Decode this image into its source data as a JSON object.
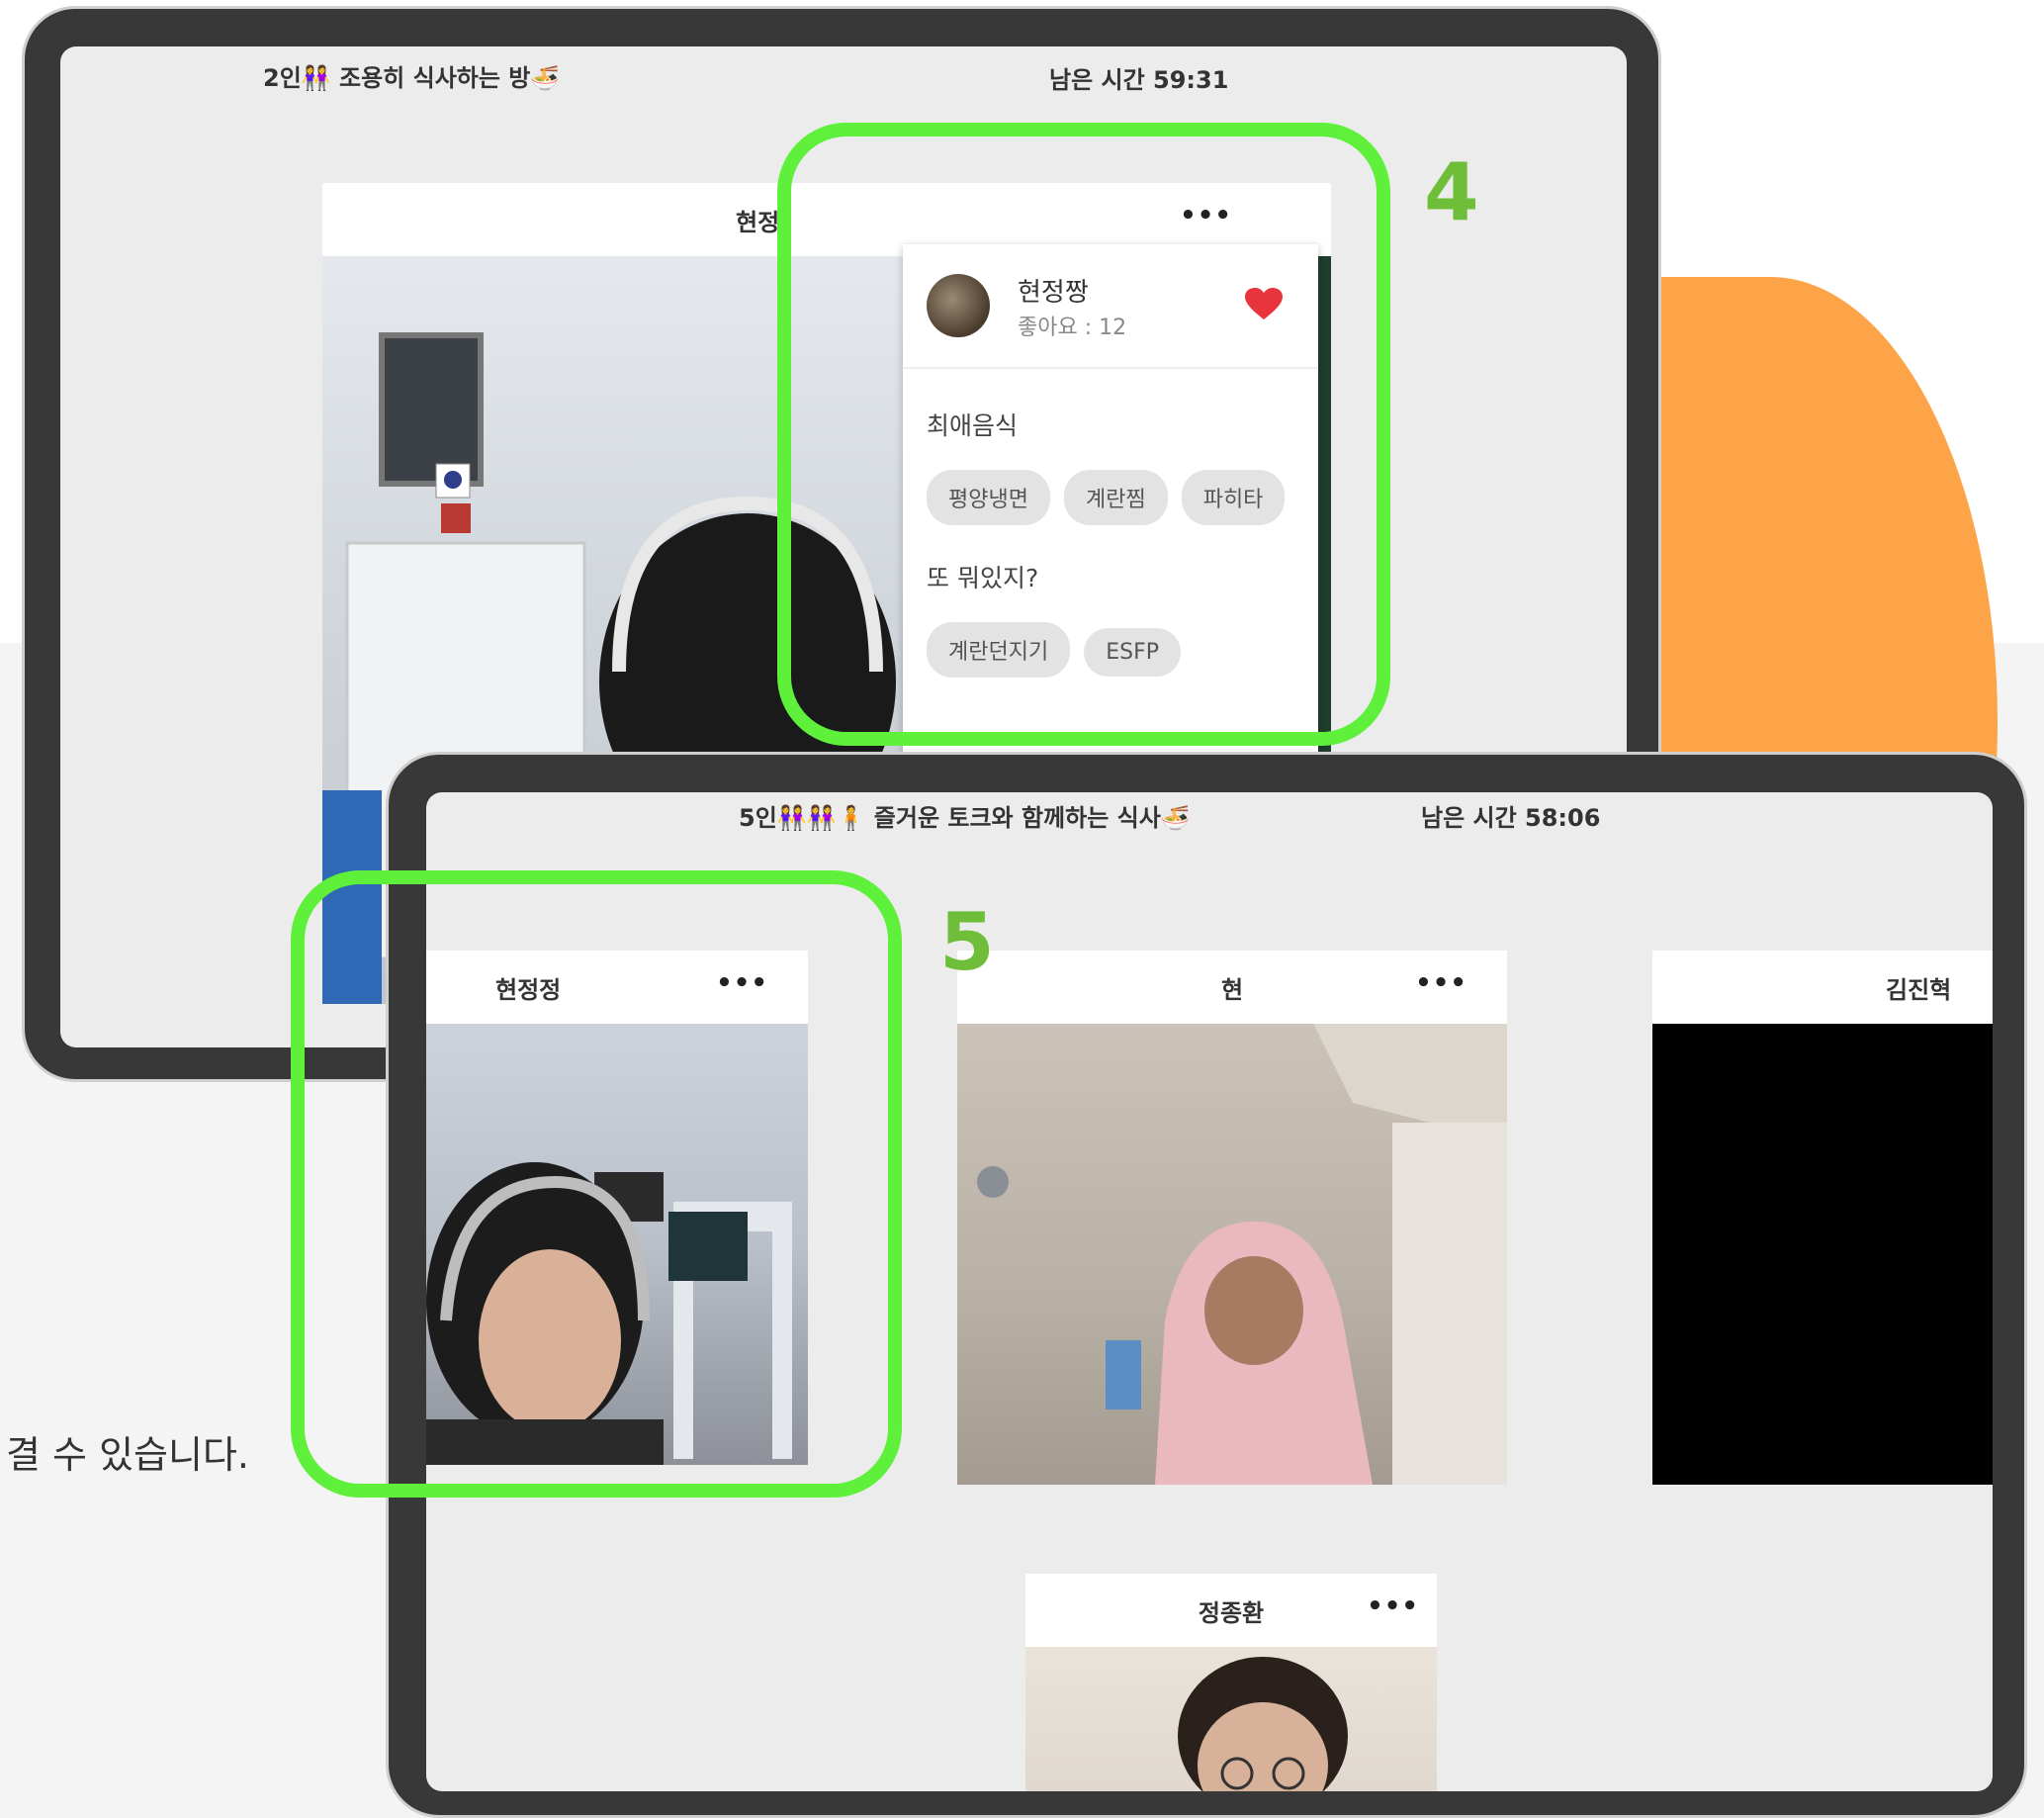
{
  "caption": "결 수 있습니다.",
  "colors": {
    "accent_green": "#5ef03b",
    "badge_green": "#6fbe3a",
    "orange": "#fca447",
    "heart": "#e8343c"
  },
  "tablet1": {
    "room_title": "2인👭 조용히 식사하는 방🍜",
    "timer": "남은 시간 59:31",
    "tile": {
      "name": "현정",
      "more": "•••"
    },
    "popup": {
      "nickname": "현정짱",
      "likes": "좋아요 : 12",
      "heart_icon": "heart-icon",
      "section1_label": "최애음식",
      "section1_chips": [
        "평양냉면",
        "계란찜",
        "파히타"
      ],
      "section2_label": "또 뭐있지?",
      "section2_chips": [
        "계란던지기",
        "ESFP"
      ]
    },
    "step_number": "4"
  },
  "tablet2": {
    "room_title": "5인👭👭🧍 즐거운 토크와 함께하는 식사🍜",
    "timer": "남은 시간 58:06",
    "tiles": [
      {
        "name": "현정정",
        "more": "•••"
      },
      {
        "name": "현",
        "more": "•••"
      },
      {
        "name": "김진혁",
        "more": ""
      },
      {
        "name": "정종환",
        "more": "•••"
      }
    ],
    "step_number": "5"
  }
}
